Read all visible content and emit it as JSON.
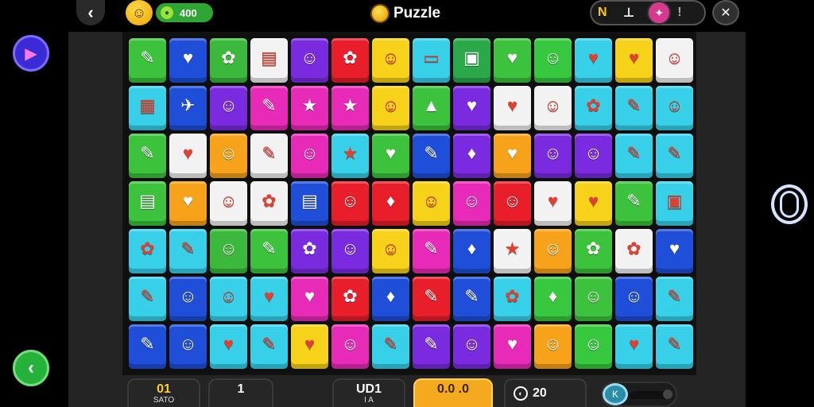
{
  "header": {
    "back_glyph": "‹",
    "avatar_glyph": "☺",
    "coins": "400",
    "title": "Puzzle",
    "tools": [
      {
        "name": "shuffle",
        "glyph": "N"
      },
      {
        "name": "bomb",
        "glyph": "⊥"
      },
      {
        "name": "hint",
        "glyph": "✦"
      }
    ],
    "tool_separator": "!",
    "settings_glyph": "✕"
  },
  "side": {
    "next_glyph": "▶",
    "prev_glyph": "‹"
  },
  "board": {
    "rows": [
      [
        [
          "#3cc23c",
          "✎"
        ],
        [
          "#1f4fd8",
          "♥"
        ],
        [
          "#3cb83c",
          "✿"
        ],
        [
          "#f2f2f2",
          "▤"
        ],
        [
          "#7a2be0",
          "☺"
        ],
        [
          "#e81e2a",
          "✿"
        ],
        [
          "#f6d21a",
          "☺"
        ],
        [
          "#38d0e8",
          "▭"
        ],
        [
          "#2aa84a",
          "▣"
        ],
        [
          "#3cc23c",
          "♥"
        ],
        [
          "#38c840",
          "☺"
        ],
        [
          "#38d0e8",
          "♥"
        ],
        [
          "#f6d21a",
          "♥"
        ],
        [
          "#f2f2f2",
          "☺"
        ]
      ],
      [
        [
          "#38d0e8",
          "▦"
        ],
        [
          "#1f4fd8",
          "✈"
        ],
        [
          "#7a2be0",
          "☺"
        ],
        [
          "#e82ab8",
          "✎"
        ],
        [
          "#e82ab8",
          "★"
        ],
        [
          "#e82ab8",
          "★"
        ],
        [
          "#f6d21a",
          "☺"
        ],
        [
          "#3cc23c",
          "▲"
        ],
        [
          "#7a2be0",
          "♥"
        ],
        [
          "#f2f2f2",
          "♥"
        ],
        [
          "#f2f2f2",
          "☺"
        ],
        [
          "#38d0e8",
          "✿"
        ],
        [
          "#38d0e8",
          "✎"
        ],
        [
          "#38d0e8",
          "☺"
        ]
      ],
      [
        [
          "#3cc23c",
          "✎"
        ],
        [
          "#f2f2f2",
          "♥"
        ],
        [
          "#f6a21a",
          "☺"
        ],
        [
          "#f2f2f2",
          "✎"
        ],
        [
          "#e82ab8",
          "☺"
        ],
        [
          "#38d0e8",
          "★"
        ],
        [
          "#3cc23c",
          "♥"
        ],
        [
          "#1f4fd8",
          "✎"
        ],
        [
          "#7a2be0",
          "♦"
        ],
        [
          "#f6a21a",
          "♥"
        ],
        [
          "#7a2be0",
          "☺"
        ],
        [
          "#7a2be0",
          "☺"
        ],
        [
          "#38d0e8",
          "✎"
        ],
        [
          "#38d0e8",
          "✎"
        ]
      ],
      [
        [
          "#3cc23c",
          "▤"
        ],
        [
          "#f6a21a",
          "♥"
        ],
        [
          "#f2f2f2",
          "☺"
        ],
        [
          "#f2f2f2",
          "✿"
        ],
        [
          "#1f4fd8",
          "▤"
        ],
        [
          "#e81e2a",
          "☺"
        ],
        [
          "#e81e2a",
          "♦"
        ],
        [
          "#f6d21a",
          "☺"
        ],
        [
          "#e82ab8",
          "☺"
        ],
        [
          "#e81e2a",
          "☺"
        ],
        [
          "#f2f2f2",
          "♥"
        ],
        [
          "#f6d21a",
          "♥"
        ],
        [
          "#3cc23c",
          "✎"
        ],
        [
          "#38d0e8",
          "▣"
        ]
      ],
      [
        [
          "#38d0e8",
          "✿"
        ],
        [
          "#38d0e8",
          "✎"
        ],
        [
          "#3cb83c",
          "☺"
        ],
        [
          "#3cc23c",
          "✎"
        ],
        [
          "#7a2be0",
          "✿"
        ],
        [
          "#7a2be0",
          "☺"
        ],
        [
          "#f6d21a",
          "☺"
        ],
        [
          "#e82ab8",
          "✎"
        ],
        [
          "#1f4fd8",
          "♦"
        ],
        [
          "#f2f2f2",
          "★"
        ],
        [
          "#f6a21a",
          "☺"
        ],
        [
          "#3cc23c",
          "✿"
        ],
        [
          "#f2f2f2",
          "✿"
        ],
        [
          "#1f4fd8",
          "♥"
        ]
      ],
      [
        [
          "#38d0e8",
          "✎"
        ],
        [
          "#1f4fd8",
          "☺"
        ],
        [
          "#38d0e8",
          "☺"
        ],
        [
          "#38d0e8",
          "♥"
        ],
        [
          "#e82ab8",
          "♥"
        ],
        [
          "#e81e2a",
          "✿"
        ],
        [
          "#1f4fd8",
          "♦"
        ],
        [
          "#e81e2a",
          "✎"
        ],
        [
          "#1f4fd8",
          "✎"
        ],
        [
          "#38d0e8",
          "✿"
        ],
        [
          "#38c840",
          "♦"
        ],
        [
          "#3cc23c",
          "☺"
        ],
        [
          "#1f4fd8",
          "☺"
        ],
        [
          "#38d0e8",
          "✎"
        ]
      ],
      [
        [
          "#1f4fd8",
          "✎"
        ],
        [
          "#1f4fd8",
          "☺"
        ],
        [
          "#38d0e8",
          "♥"
        ],
        [
          "#38d0e8",
          "✎"
        ],
        [
          "#f6d21a",
          "♥"
        ],
        [
          "#e82ab8",
          "☺"
        ],
        [
          "#38d0e8",
          "✎"
        ],
        [
          "#7a2be0",
          "✎"
        ],
        [
          "#7a2be0",
          "☺"
        ],
        [
          "#e82ab8",
          "♥"
        ],
        [
          "#f6a21a",
          "☺"
        ],
        [
          "#38c840",
          "☺"
        ],
        [
          "#38d0e8",
          "♥"
        ],
        [
          "#38d0e8",
          "✎"
        ]
      ]
    ]
  },
  "footer": {
    "stats": [
      {
        "value": "01",
        "label": "SATO"
      },
      {
        "value": "1",
        "label": ""
      },
      {
        "value": "UD1",
        "label": "I A"
      },
      {
        "value": "0.0 .0",
        "label": ""
      },
      {
        "value": "20",
        "label": ""
      }
    ],
    "stat5_icon": "◐",
    "volume_glyph": "K",
    "volume_level": 0.55
  }
}
